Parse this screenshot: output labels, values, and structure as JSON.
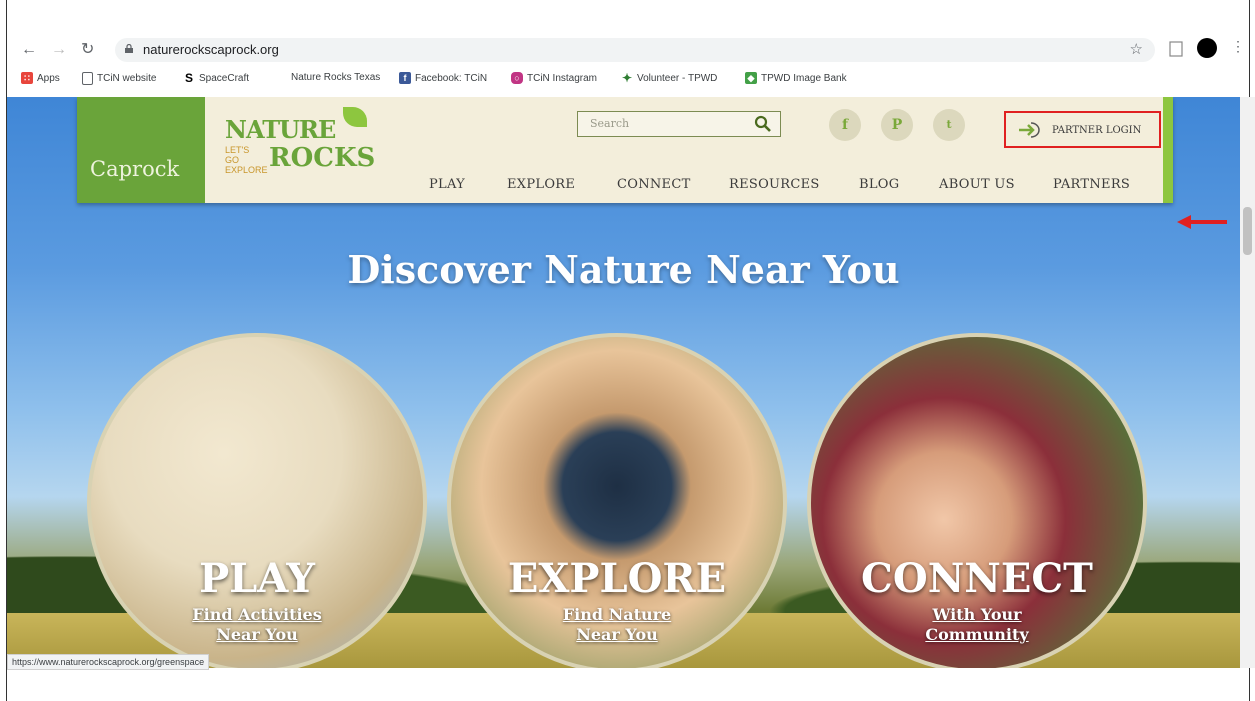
{
  "browser": {
    "url": "naturerockscaprock.org",
    "status_url": "https://www.naturerockscaprock.org/greenspace",
    "bookmarks": [
      {
        "label": "Apps",
        "icon": "apps-grid-icon",
        "color": "#e8453c"
      },
      {
        "label": "TCiN website",
        "icon": "page-icon",
        "color": "#5f6368"
      },
      {
        "label": "SpaceCraft",
        "icon": "s-logo-icon",
        "color": "#000000"
      },
      {
        "label": "Nature Rocks Texas",
        "icon": "",
        "color": ""
      },
      {
        "label": "Facebook: TCiN",
        "icon": "facebook-icon",
        "color": "#3b5998"
      },
      {
        "label": "TCiN Instagram",
        "icon": "instagram-icon",
        "color": "#c13584"
      },
      {
        "label": "Volunteer - TPWD",
        "icon": "tpwd-leaf-icon",
        "color": "#2e7d32"
      },
      {
        "label": "TPWD Image Bank",
        "icon": "tpwd-cube-icon",
        "color": "#43a047"
      }
    ]
  },
  "site": {
    "region": "Caprock",
    "logo": {
      "line1": "NATURE",
      "line2": "LET'S GO EXPLORE",
      "line3": "ROCKS"
    },
    "search_placeholder": "Search",
    "social": [
      "f",
      "P",
      "t"
    ],
    "partner_login": "PARTNER LOGIN",
    "nav": [
      "PLAY",
      "EXPLORE",
      "CONNECT",
      "RESOURCES",
      "BLOG",
      "ABOUT US",
      "PARTNERS"
    ]
  },
  "hero": {
    "title": "Discover Nature Near You",
    "cards": [
      {
        "title": "PLAY",
        "sub1": "Find Activities",
        "sub2": "Near You"
      },
      {
        "title": "EXPLORE",
        "sub1": "Find Nature",
        "sub2": "Near You"
      },
      {
        "title": "CONNECT",
        "sub1": "With Your",
        "sub2": "Community"
      }
    ]
  },
  "colors": {
    "brand_green": "#6aa43a",
    "header_bg": "#f3eedb",
    "annotation_red": "#e02020"
  }
}
